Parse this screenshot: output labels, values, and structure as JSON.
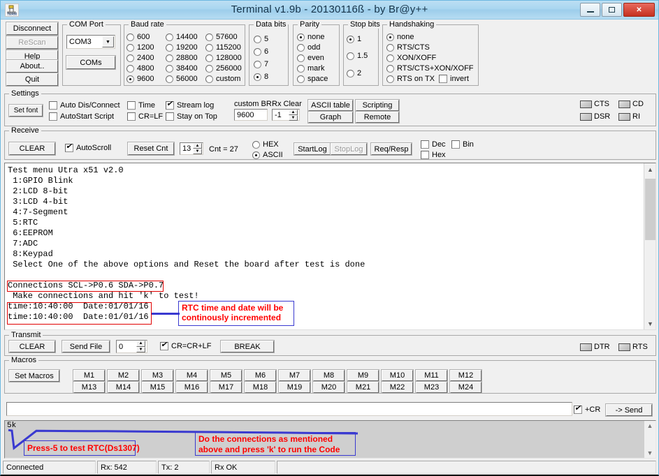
{
  "window": {
    "title": "Terminal v1.9b - 20130116ß - by Br@y++",
    "icon": "serial-terminal-icon",
    "minimize_label": "–",
    "maximize_label": "□",
    "close_label": "✕"
  },
  "left_buttons": [
    {
      "label": "Disconnect",
      "enabled": true
    },
    {
      "label": "ReScan",
      "enabled": false
    },
    {
      "label": "Help",
      "enabled": true
    },
    {
      "label": "About..",
      "enabled": true
    },
    {
      "label": "Quit",
      "enabled": true
    }
  ],
  "com_port": {
    "legend": "COM Port",
    "selected": "COM3",
    "coms_button": "COMs",
    "dropdown_icon": "chevron-down-icon"
  },
  "baud_rate": {
    "legend": "Baud rate",
    "selected": "9600",
    "col1": [
      "600",
      "1200",
      "2400",
      "4800",
      "9600"
    ],
    "col2": [
      "14400",
      "19200",
      "28800",
      "38400",
      "56000"
    ],
    "col3": [
      "57600",
      "115200",
      "128000",
      "256000",
      "custom"
    ]
  },
  "data_bits": {
    "legend": "Data bits",
    "selected": "8",
    "options": [
      "5",
      "6",
      "7",
      "8"
    ]
  },
  "parity": {
    "legend": "Parity",
    "selected": "none",
    "options": [
      "none",
      "odd",
      "even",
      "mark",
      "space"
    ]
  },
  "stop_bits": {
    "legend": "Stop bits",
    "selected": "1",
    "options": [
      "1",
      "1.5",
      "2"
    ]
  },
  "handshaking": {
    "legend": "Handshaking",
    "selected": "none",
    "options": [
      "none",
      "RTS/CTS",
      "XON/XOFF",
      "RTS/CTS+XON/XOFF",
      "RTS on TX"
    ],
    "invert_label": "invert",
    "invert_checked": false
  },
  "settings": {
    "legend": "Settings",
    "set_font": "Set font",
    "checks": [
      {
        "label": "Auto Dis/Connect",
        "checked": false
      },
      {
        "label": "AutoStart Script",
        "checked": false
      },
      {
        "label": "Time",
        "checked": false
      },
      {
        "label": "CR=LF",
        "checked": false
      },
      {
        "label": "Stream log",
        "checked": true
      },
      {
        "label": "Stay on Top",
        "checked": false
      }
    ],
    "custom_br_label": "custom BR",
    "custom_br_value": "9600",
    "rx_clear_label": "Rx Clear",
    "rx_clear_value": "-1",
    "ascii_table": "ASCII table",
    "scripting": "Scripting",
    "graph": "Graph",
    "remote": "Remote",
    "leds": [
      "CTS",
      "CD",
      "DSR",
      "RI"
    ]
  },
  "receive": {
    "legend": "Receive",
    "clear": "CLEAR",
    "autoscroll_label": "AutoScroll",
    "autoscroll_checked": true,
    "reset_cnt": "Reset Cnt",
    "cnt_field": "13",
    "cnt_text": "Cnt = 27",
    "hex_label": "HEX",
    "ascii_label": "ASCII",
    "mode_selected": "ASCII",
    "startlog": "StartLog",
    "stoplog": "StopLog",
    "stoplog_enabled": false,
    "req_resp": "Req/Resp",
    "dec_label": "Dec",
    "hex_check_label": "Hex",
    "bin_label": "Bin"
  },
  "terminal": {
    "text": "Test menu Utra x51 v2.0\n 1:GPIO Blink\n 2:LCD 8-bit\n 3:LCD 4-bit\n 4:7-Segment\n 5:RTC\n 6:EEPROM\n 7:ADC\n 8:Keypad\n Select One of the above options and Reset the board after test is done\n\nConnections SCL->P0.6 SDA->P0.7\n Make connections and hit 'k' to test!\ntime:10:40:00  Date:01/01/16\ntime:10:40:00  Date:01/01/16",
    "scroll_up_icon": "chevron-up-icon",
    "scroll_down_icon": "chevron-down-icon"
  },
  "annotations": {
    "rtc_note": "RTC time and date will be\ncontinously incremented",
    "press5_note": "Press-5 to test RTC(Ds1307)",
    "connections_note": "Do the connections as mentioned\nabove and press 'k' to run the Code",
    "box_color": "#3a3ad0",
    "text_color": "#ff0000",
    "highlight_color": "#e00000"
  },
  "transmit": {
    "legend": "Transmit",
    "clear": "CLEAR",
    "send_file": "Send File",
    "delay_value": "0",
    "crcrlf_label": "CR=CR+LF",
    "crcrlf_checked": true,
    "break": "BREAK",
    "leds": [
      "DTR",
      "RTS"
    ]
  },
  "macros": {
    "legend": "Macros",
    "set_macros": "Set Macros",
    "row1": [
      "M1",
      "M2",
      "M3",
      "M4",
      "M5",
      "M6",
      "M7",
      "M8",
      "M9",
      "M10",
      "M11",
      "M12"
    ],
    "row2": [
      "M13",
      "M14",
      "M15",
      "M16",
      "M17",
      "M18",
      "M19",
      "M20",
      "M21",
      "M22",
      "M23",
      "M24"
    ]
  },
  "send_bar": {
    "input_value": "",
    "cr_label": "+CR",
    "cr_checked": true,
    "send_label": "-> Send"
  },
  "chart_data": {
    "type": "line",
    "title": "",
    "axis_label": "5k",
    "ylabel": "5k",
    "xlabel": "",
    "grid": false,
    "legend": "none",
    "line_color": "#3a3ad0",
    "ylim": [
      0,
      5000
    ],
    "x": [
      0,
      5,
      8,
      40,
      90,
      140,
      190,
      240,
      290,
      340,
      390,
      440,
      500
    ],
    "values": [
      4700,
      4600,
      1200,
      4550,
      4520,
      4480,
      4430,
      4380,
      4320,
      4260,
      4200,
      4120,
      4050
    ]
  },
  "status_bar": {
    "connection": "Connected",
    "rx": "Rx: 542",
    "tx": "Tx: 2",
    "rx_state": "Rx OK",
    "extra": ""
  }
}
